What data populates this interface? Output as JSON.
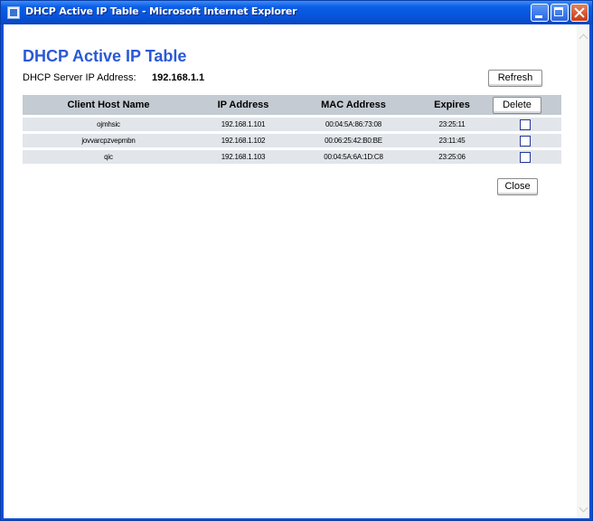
{
  "window": {
    "title": "DHCP Active IP Table - Microsoft Internet Explorer"
  },
  "page": {
    "title": "DHCP Active IP Table",
    "server_label": "DHCP Server IP Address:",
    "server_ip": "192.168.1.1"
  },
  "buttons": {
    "refresh": "Refresh",
    "delete": "Delete",
    "close": "Close"
  },
  "table": {
    "columns": [
      "Client Host Name",
      "IP Address",
      "MAC Address",
      "Expires"
    ],
    "rows": [
      {
        "host": "ojmhsic",
        "ip": "192.168.1.101",
        "mac": "00:04:5A:86:73:08",
        "expires": "23:25:11"
      },
      {
        "host": "jovvarcpzvepmbn",
        "ip": "192.168.1.102",
        "mac": "00:06:25:42:B0:BE",
        "expires": "23:11:45"
      },
      {
        "host": "qic",
        "ip": "192.168.1.103",
        "mac": "00:04:5A:6A:1D:C8",
        "expires": "23:25:06"
      }
    ]
  },
  "colors": {
    "title_blue": "#2a59d6",
    "header_gray": "#c4cbd2",
    "row_gray": "#e2e6ea",
    "titlebar_blue": "#0a5ee8"
  }
}
